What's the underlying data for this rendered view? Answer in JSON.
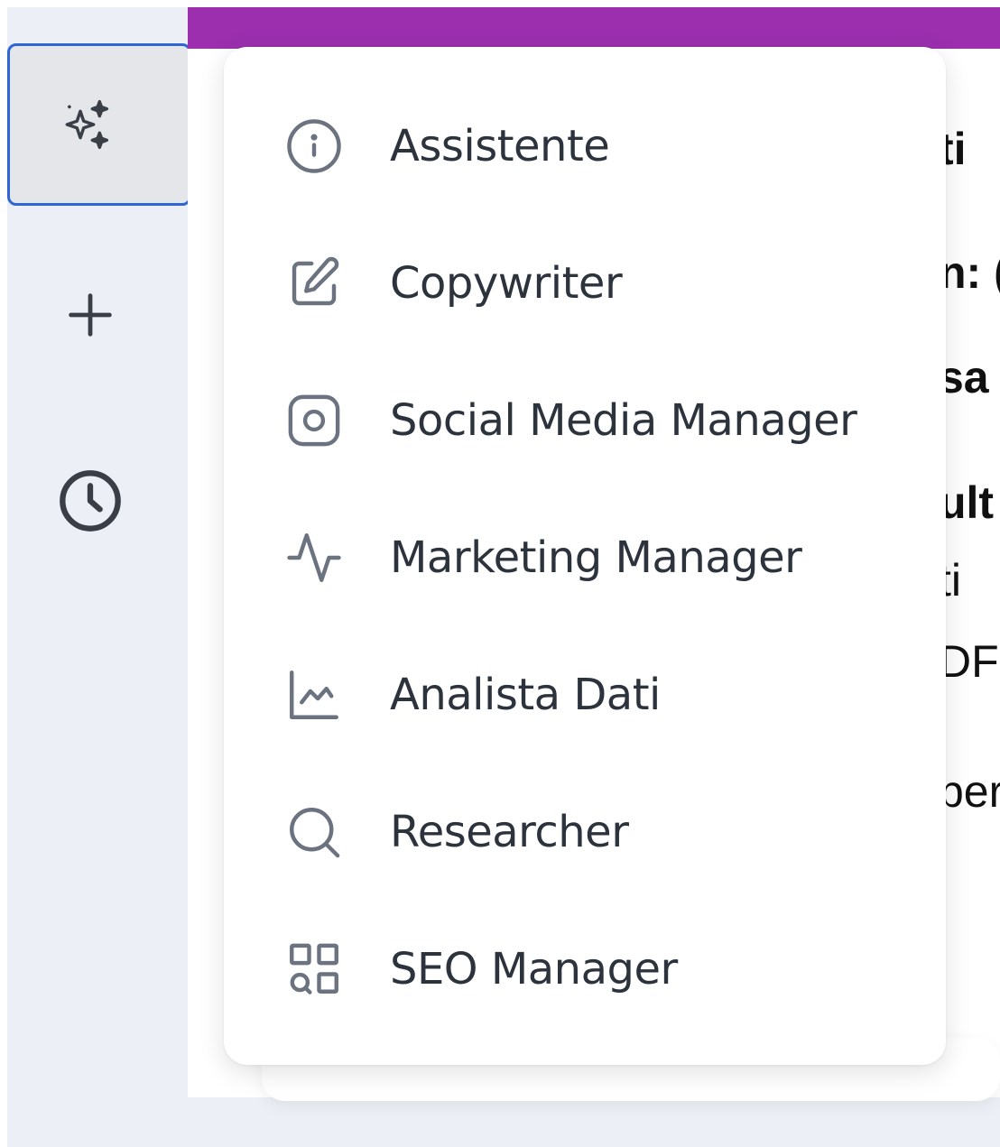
{
  "colors": {
    "topbar": "#9b2fae",
    "rail_background": "#eceff6",
    "active_border": "#2f66d6",
    "icon": "#6b7280",
    "label": "#2c333d"
  },
  "rail": {
    "items": [
      {
        "icon": "sparkles-icon",
        "active": true
      },
      {
        "icon": "plus-icon",
        "active": false
      },
      {
        "icon": "clock-icon",
        "active": false
      }
    ]
  },
  "menu": {
    "items": [
      {
        "label": "Assistente",
        "icon": "info-circle-icon"
      },
      {
        "label": "Copywriter",
        "icon": "edit-icon"
      },
      {
        "label": "Social Media Manager",
        "icon": "instagram-icon"
      },
      {
        "label": "Marketing Manager",
        "icon": "activity-icon"
      },
      {
        "label": "Analista Dati",
        "icon": "chart-line-icon"
      },
      {
        "label": "Researcher",
        "icon": "search-icon"
      },
      {
        "label": "SEO Manager",
        "icon": "grid-search-icon"
      }
    ]
  },
  "background": {
    "fragments": [
      "ti",
      "n: (",
      "sa",
      "ult",
      "ti",
      "DF",
      "per"
    ]
  }
}
